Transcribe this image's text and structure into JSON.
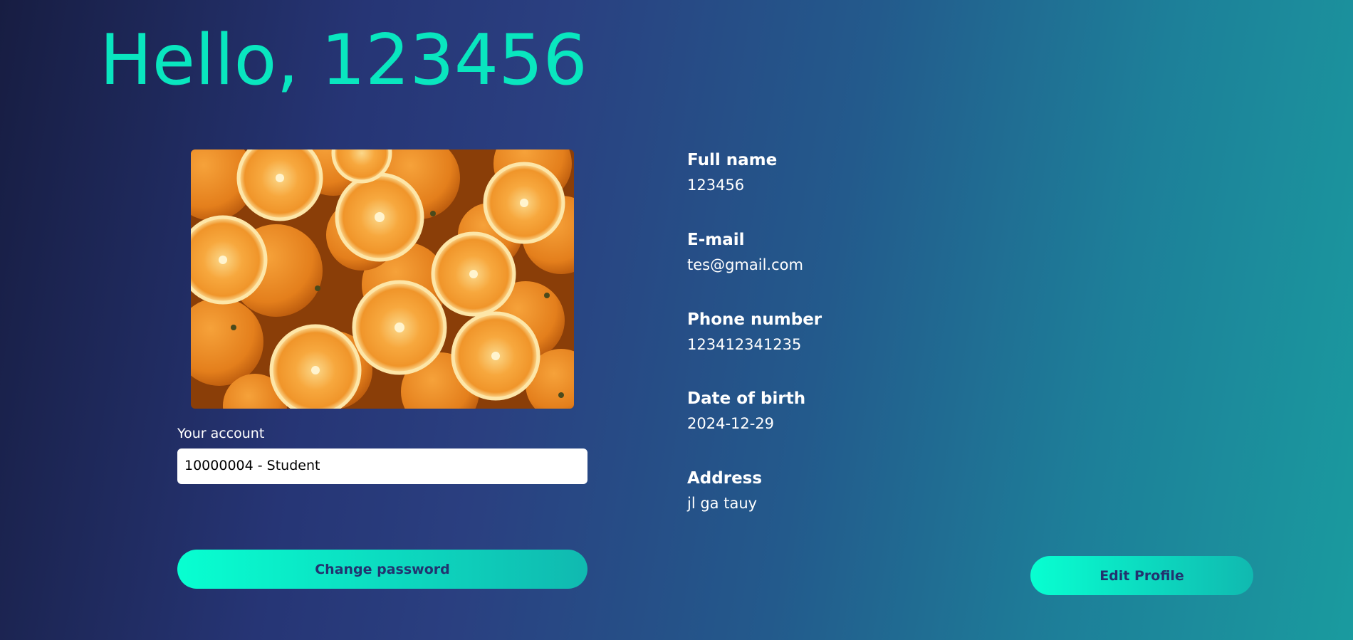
{
  "greeting": "Hello, 123456",
  "account": {
    "label": "Your account",
    "selected": "10000004 - Student"
  },
  "buttons": {
    "change_password": "Change password",
    "edit_profile": "Edit Profile"
  },
  "profile_fields": [
    {
      "label": "Full name",
      "value": "123456"
    },
    {
      "label": "E-mail",
      "value": "tes@gmail.com"
    },
    {
      "label": "Phone number",
      "value": "123412341235"
    },
    {
      "label": "Date of birth",
      "value": "2024-12-29"
    },
    {
      "label": "Address",
      "value": "jl ga tauy"
    }
  ],
  "colors": {
    "accent": "#09e6bf",
    "button_text": "#22336f"
  }
}
